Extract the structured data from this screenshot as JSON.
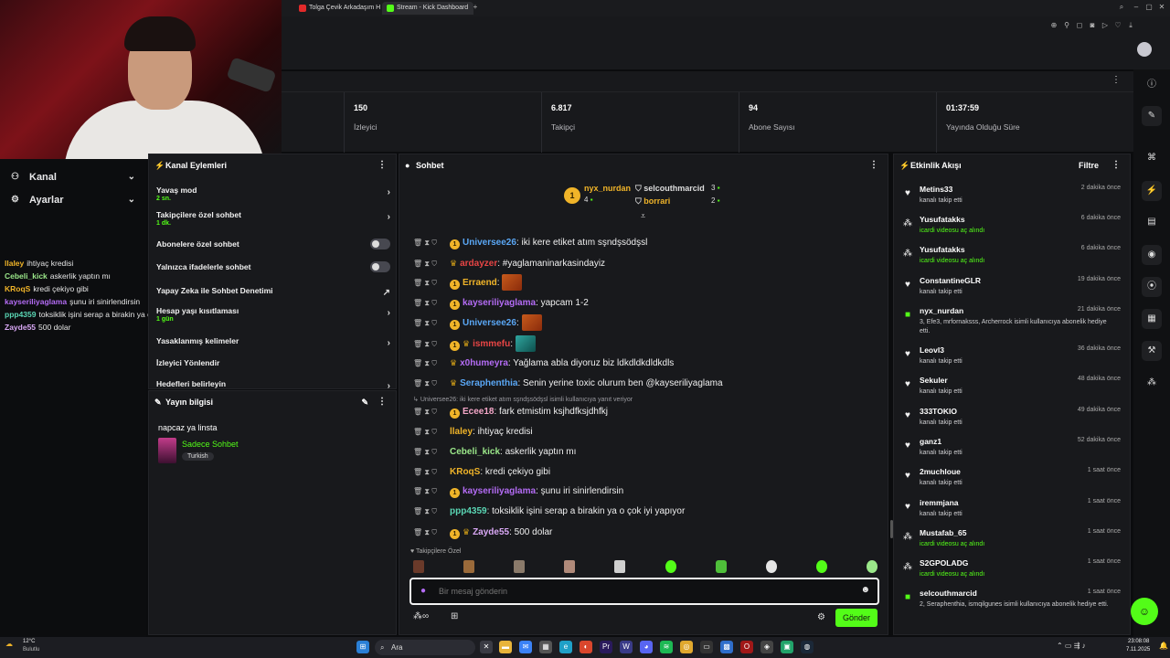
{
  "browser": {
    "tabs": [
      {
        "label": "Tolga Çevik Arkadaşım H",
        "color": "#e22a2a"
      },
      {
        "label": "Stream - Kick Dashboard",
        "color": "#53fc18"
      }
    ]
  },
  "left_nav": {
    "items": [
      {
        "label": "Kanal",
        "icon": "users-icon"
      },
      {
        "label": "Ayarlar",
        "icon": "gear-icon"
      }
    ],
    "chat_overlay": [
      {
        "user": "llaley",
        "text": "ihtiyaç kredisi",
        "color": "#f0b429"
      },
      {
        "user": "Cebeli_kick",
        "text": "askerlik yaptın mı",
        "color": "#9be88a"
      },
      {
        "user": "KRoqS",
        "text": "kredi çekiyo gibi",
        "color": "#f0b429"
      },
      {
        "user": "kayseriliyaglama",
        "text": "şunu iri sinirlendirsin",
        "color": "#b46cf5"
      },
      {
        "user": "ppp4359",
        "text": "toksiklik işini serap a birakin ya o çok iyi yapıyor",
        "color": "#5ad6b4"
      },
      {
        "user": "Zayde55",
        "text": "500 dolar",
        "color": "#d9a8f5"
      }
    ]
  },
  "stats": [
    {
      "value": "150",
      "label": "İzleyici"
    },
    {
      "value": "6.817",
      "label": "Takipçi"
    },
    {
      "value": "94",
      "label": "Abone Sayısı"
    },
    {
      "value": "01:37:59",
      "label": "Yayında Olduğu Süre"
    }
  ],
  "kanal_eylemleri": {
    "title": "Kanal Eylemleri",
    "rows": [
      {
        "label": "Yavaş mod",
        "sub": "2 sn.",
        "control": "arrow"
      },
      {
        "label": "Takipçilere özel sohbet",
        "sub": "1 dk.",
        "control": "arrow"
      },
      {
        "label": "Abonelere özel sohbet",
        "sub": "",
        "control": "toggle"
      },
      {
        "label": "Yalnızca ifadelerle sohbet",
        "sub": "",
        "control": "toggle"
      },
      {
        "label": "Yapay Zeka ile Sohbet Denetimi",
        "sub": "",
        "control": "external"
      },
      {
        "label": "Hesap yaşı kısıtlaması",
        "sub": "1 gün",
        "control": "arrow"
      },
      {
        "label": "Yasaklanmış kelimeler",
        "sub": "",
        "control": "arrow"
      },
      {
        "label": "İzleyici Yönlendir",
        "sub": "",
        "control": "none"
      },
      {
        "label": "Hedefleri belirleyin",
        "sub": "",
        "control": "arrow"
      }
    ]
  },
  "yayin_bilgisi": {
    "title": "Yayın bilgisi",
    "stream_title": "napcaz ya linsta",
    "category": "Sadece Sohbet",
    "tag": "Turkish"
  },
  "chat": {
    "title": "Sohbet",
    "top_gifters": [
      {
        "name": "nyx_nurdan",
        "count": "4"
      },
      {
        "name": "selcouthmarcid",
        "count": "3"
      },
      {
        "name": "borrari",
        "count": "2"
      }
    ],
    "messages": [
      {
        "user": "Universee26",
        "text": ": iki kere etiket atım sşndşsödşsl",
        "color": "#5aa7f5",
        "badge": true,
        "wreath": true,
        "emote": false
      },
      {
        "user": "ardayzer",
        "text": ": #yaglamaninarkasindayiz",
        "color": "#e84545",
        "badge": false,
        "wreath": true,
        "emote": false
      },
      {
        "user": "Erraend",
        "text": ":",
        "color": "#f0b429",
        "badge": true,
        "wreath": false,
        "emote": true
      },
      {
        "user": "kayseriliyaglama",
        "text": ": yapcam 1-2",
        "color": "#b46cf5",
        "badge": true,
        "wreath": false,
        "emote": false
      },
      {
        "user": "Universee26",
        "text": ":",
        "color": "#5aa7f5",
        "badge": true,
        "wreath": false,
        "emote": true
      },
      {
        "user": "ismmefu",
        "text": ":",
        "color": "#e84545",
        "badge": true,
        "wreath": true,
        "emote": true
      },
      {
        "user": "x0humeyra",
        "text": ": Yağlama abla diyoruz biz ldkdldkdldkdls",
        "color": "#b46cf5",
        "badge": false,
        "wreath": true,
        "emote": false
      },
      {
        "user": "Seraphenthia",
        "text": ": Senin yerine toxic olurum ben @kayseriliyaglama",
        "color": "#5aa7f5",
        "badge": false,
        "wreath": true,
        "emote": false
      },
      {
        "user": "Ecee18",
        "text": ": fark etmistim ksjhdfksjdhfkj",
        "color": "#f5a7c8",
        "badge": true,
        "wreath": false,
        "emote": false
      },
      {
        "user": "llaley",
        "text": ": ihtiyaç kredisi",
        "color": "#f0b429",
        "badge": false,
        "wreath": false,
        "emote": false
      },
      {
        "user": "Cebeli_kick",
        "text": ": askerlik yaptın mı",
        "color": "#9be88a",
        "badge": false,
        "wreath": false,
        "emote": false
      },
      {
        "user": "KRoqS",
        "text": ": kredi çekiyo gibi",
        "color": "#f0b429",
        "badge": false,
        "wreath": false,
        "emote": false
      },
      {
        "user": "kayseriliyaglama",
        "text": ": şunu iri sinirlendirsin",
        "color": "#b46cf5",
        "badge": true,
        "wreath": false,
        "emote": false
      },
      {
        "user": "ppp4359",
        "text": ": toksiklik işini serap a birakin ya o çok iyi yapıyor",
        "color": "#5ad6b4",
        "badge": false,
        "wreath": false,
        "emote": false
      },
      {
        "user": "Zayde55",
        "text": ": 500 dolar",
        "color": "#d9a8f5",
        "badge": true,
        "wreath": true,
        "emote": false
      }
    ],
    "reply_note": "Universee26: iki kere etiket atım sşndşsödşsl isimli kullanıcıya yanıt veriyor",
    "followers_only_label": "Takipçilere Özel",
    "input_placeholder": "Bir mesaj gönderin",
    "send_label": "Gönder"
  },
  "activity": {
    "title": "Etkinlik Akışı",
    "filter_label": "Filtre",
    "events": [
      {
        "name": "Metins33",
        "desc": "kanalı takip etti",
        "time": "2 dakika önce",
        "icon": "heart-icon",
        "green": false
      },
      {
        "name": "Yusufatakks",
        "desc": "icardi videosu aç alındı",
        "time": "6 dakika önce",
        "icon": "channel-points-icon",
        "green": true
      },
      {
        "name": "Yusufatakks",
        "desc": "icardi videosu aç alındı",
        "time": "6 dakika önce",
        "icon": "channel-points-icon",
        "green": true
      },
      {
        "name": "ConstantineGLR",
        "desc": "kanalı takip etti",
        "time": "19 dakika önce",
        "icon": "heart-icon",
        "green": false
      },
      {
        "name": "nyx_nurdan",
        "desc": "3, Efe3, mrfornaksss, Archerrock isimli kullanıcıya abonelik hediye etti.",
        "time": "21 dakika önce",
        "icon": "gift-icon",
        "green": false
      },
      {
        "name": "Leovl3",
        "desc": "kanalı takip etti",
        "time": "36 dakika önce",
        "icon": "heart-icon",
        "green": false
      },
      {
        "name": "Sekuler",
        "desc": "kanalı takip etti",
        "time": "48 dakika önce",
        "icon": "heart-icon",
        "green": false
      },
      {
        "name": "333TOKIO",
        "desc": "kanalı takip etti",
        "time": "49 dakika önce",
        "icon": "heart-icon",
        "green": false
      },
      {
        "name": "ganz1",
        "desc": "kanalı takip etti",
        "time": "52 dakika önce",
        "icon": "heart-icon",
        "green": false
      },
      {
        "name": "2muchloue",
        "desc": "kanalı takip etti",
        "time": "1 saat önce",
        "icon": "heart-icon",
        "green": false
      },
      {
        "name": "iremmjana",
        "desc": "kanalı takip etti",
        "time": "1 saat önce",
        "icon": "heart-icon",
        "green": false
      },
      {
        "name": "Mustafab_65",
        "desc": "icardi videosu aç alındı",
        "time": "1 saat önce",
        "icon": "channel-points-icon",
        "green": true
      },
      {
        "name": "S2GPOLADG",
        "desc": "icardi videosu aç alındı",
        "time": "1 saat önce",
        "icon": "channel-points-icon",
        "green": true
      },
      {
        "name": "selcouthmarcid",
        "desc": "2, Seraphenthia, ismqilgunes isimli kullanıcıya abonelik hediye etti.",
        "time": "1 saat önce",
        "icon": "gift-icon",
        "green": false
      }
    ]
  },
  "taskbar": {
    "weather_temp": "12°C",
    "weather_desc": "Bulutlu",
    "search_label": "Ara",
    "time": "23:08:08",
    "date": "7.11.2025"
  },
  "colors": {
    "accent": "#53fc18",
    "panel": "#18191c",
    "background": "#0b0c0e"
  }
}
